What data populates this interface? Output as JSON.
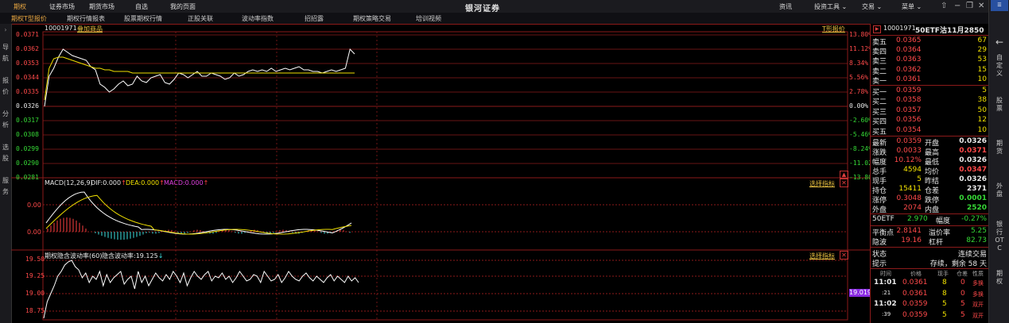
{
  "topbar": {
    "tabs": [
      "期权",
      "证券市场",
      "期货市场",
      "自选",
      "我的页面"
    ],
    "brand": "银河证券",
    "menus": [
      "资讯",
      "投资工具 ⌄",
      "交易 ⌄",
      "菜单 ⌄"
    ]
  },
  "subbar": {
    "tabs": [
      "期权T型报价",
      "期权行情报表",
      "股票期权行情",
      "正股关联",
      "波动率指数",
      "招招露",
      "期权策略交易",
      "培训视频"
    ]
  },
  "leftstrip": [
    "导",
    "航",
    "报",
    "价",
    "分",
    "析",
    "选",
    "股",
    "服",
    "务"
  ],
  "rightstrip": [
    "←",
    "自定义",
    "股票",
    "期货",
    "外盘",
    "银行OTC",
    "期权"
  ],
  "chart": {
    "code": "10001971",
    "add_label": "叠加商品",
    "tline_label": "T形报价",
    "price_ticks": [
      "0.0371",
      "0.0362",
      "0.0353",
      "0.0344",
      "0.0335",
      "0.0326",
      "0.0317",
      "0.0308",
      "0.0299",
      "0.0290",
      "0.0281"
    ],
    "pct_ticks": [
      "13.80%",
      "11.12%",
      "8.34%",
      "5.56%",
      "2.78%",
      "0.00%",
      "-2.60%",
      "-5.46%",
      "-8.24%",
      "-11.02%",
      "-13.80%"
    ],
    "price_line": [
      0.0326,
      0.0345,
      0.035,
      0.0357,
      0.0362,
      0.036,
      0.0358,
      0.0357,
      0.0356,
      0.0355,
      0.0351,
      0.0349,
      0.034,
      0.0338,
      0.0335,
      0.0337,
      0.034,
      0.0342,
      0.0339,
      0.034,
      0.0345,
      0.0342,
      0.0341,
      0.0344,
      0.0345,
      0.0346,
      0.0341,
      0.034,
      0.0343,
      0.0347,
      0.0346,
      0.0344,
      0.0346,
      0.0348,
      0.0345,
      0.0345,
      0.0347,
      0.0346,
      0.0345,
      0.0343,
      0.0344,
      0.0347,
      0.0345,
      0.0346,
      0.0348,
      0.0349,
      0.0348,
      0.0349,
      0.0348,
      0.035,
      0.0348,
      0.0349,
      0.035,
      0.0349,
      0.035,
      0.0351,
      0.0349,
      0.0349,
      0.0348,
      0.0348,
      0.0347,
      0.0348,
      0.0349,
      0.0348,
      0.0349,
      0.035,
      0.0362,
      0.0359
    ],
    "avg_line": [
      0.033,
      0.035,
      0.0356,
      0.0357,
      0.0357,
      0.0356,
      0.0355,
      0.0354,
      0.0353,
      0.0352,
      0.0351,
      0.035,
      0.035,
      0.0349,
      0.0349,
      0.0348,
      0.0348,
      0.0348,
      0.0348,
      0.0347,
      0.0347,
      0.0347,
      0.0347,
      0.0347,
      0.0347,
      0.0347,
      0.0347,
      0.0347,
      0.0347,
      0.0347,
      0.0347,
      0.0347,
      0.0347,
      0.0347,
      0.0347,
      0.0347,
      0.0347,
      0.0347,
      0.0347,
      0.0347,
      0.0347,
      0.0347,
      0.0347,
      0.0347,
      0.0347,
      0.0347,
      0.0347,
      0.0347,
      0.0347,
      0.0347,
      0.0347,
      0.0347,
      0.0347,
      0.0347,
      0.0347,
      0.0347,
      0.0347,
      0.0347,
      0.0347,
      0.0347,
      0.0347,
      0.0347,
      0.0347,
      0.0347,
      0.0347,
      0.0347,
      0.0347,
      0.0347
    ],
    "macd_title": "MACD(12,26,9)",
    "dif_label": "DIF:0.000",
    "dea_label": "DEA:0.000",
    "macd_label": "MACD:0.000",
    "select_indicator": "选择指标",
    "macd_ticks": [
      "0.00",
      "0.00"
    ],
    "iv_title": "期权隐含波动率(60)",
    "iv_label": "隐含波动率:19.125",
    "iv_ticks": [
      "19.50",
      "19.25",
      "19.00",
      "18.75"
    ],
    "iv_current": "19.019"
  },
  "quote": {
    "header_code": "10001971",
    "header_name": "50ETF沽11月2850",
    "asks": [
      {
        "label": "卖五",
        "price": "0.0365",
        "vol": "67"
      },
      {
        "label": "卖四",
        "price": "0.0364",
        "vol": "29"
      },
      {
        "label": "卖三",
        "price": "0.0363",
        "vol": "53"
      },
      {
        "label": "卖二",
        "price": "0.0362",
        "vol": "15"
      },
      {
        "label": "卖一",
        "price": "0.0361",
        "vol": "10"
      }
    ],
    "bids": [
      {
        "label": "买一",
        "price": "0.0359",
        "vol": "5"
      },
      {
        "label": "买二",
        "price": "0.0358",
        "vol": "38"
      },
      {
        "label": "买三",
        "price": "0.0357",
        "vol": "50"
      },
      {
        "label": "买四",
        "price": "0.0356",
        "vol": "12"
      },
      {
        "label": "买五",
        "price": "0.0354",
        "vol": "10"
      }
    ],
    "stats": [
      {
        "l1": "最新",
        "v1": "0.0359",
        "c1": "red",
        "l2": "开盘",
        "v2": "0.0326",
        "c2": "white"
      },
      {
        "l1": "涨跌",
        "v1": "0.0033",
        "c1": "red",
        "l2": "最高",
        "v2": "0.0371",
        "c2": "red"
      },
      {
        "l1": "幅度",
        "v1": "10.12%",
        "c1": "red",
        "l2": "最低",
        "v2": "0.0326",
        "c2": "white"
      },
      {
        "l1": "总手",
        "v1": "4594",
        "c1": "yellow",
        "l2": "均价",
        "v2": "0.0347",
        "c2": "red"
      },
      {
        "l1": "现手",
        "v1": "5",
        "c1": "yellow",
        "l2": "昨结",
        "v2": "0.0326",
        "c2": "white"
      },
      {
        "l1": "持仓",
        "v1": "15411",
        "c1": "yellow",
        "l2": "仓差",
        "v2": "2371",
        "c2": "white"
      },
      {
        "l1": "涨停",
        "v1": "0.3048",
        "c1": "red",
        "l2": "跌停",
        "v2": "0.0001",
        "c2": "green"
      },
      {
        "l1": "外盘",
        "v1": "2074",
        "c1": "red",
        "l2": "内盘",
        "v2": "2520",
        "c2": "green"
      }
    ],
    "etf": {
      "label": "50ETF",
      "price": "2.970",
      "fudu_label": "幅度",
      "fudu": "-0.27%"
    },
    "extra": [
      {
        "l1": "平衡点",
        "v1": "2.8141",
        "l2": "溢价率",
        "v2": "5.25"
      },
      {
        "l1": "隐波",
        "v1": "19.16",
        "l2": "杠杆",
        "v2": "82.73"
      }
    ],
    "status_label": "状态",
    "status_value": "连续交易",
    "tip_label": "提示",
    "tip_value": "存续，剩余 58 天",
    "trade_headers": [
      "时间",
      "价格",
      "现手",
      "仓差",
      "性质"
    ],
    "trades": [
      {
        "time": "11:01",
        "price": "0.0361",
        "vol": "8",
        "diff": "0",
        "kind": "多换"
      },
      {
        "time": ":21",
        "price": "0.0361",
        "vol": "8",
        "diff": "0",
        "kind": "多换"
      },
      {
        "time": "11:02",
        "price": "0.0359",
        "vol": "5",
        "diff": "5",
        "kind": "双开"
      },
      {
        "time": ":39",
        "price": "0.0359",
        "vol": "5",
        "diff": "5",
        "kind": "双开"
      }
    ]
  }
}
